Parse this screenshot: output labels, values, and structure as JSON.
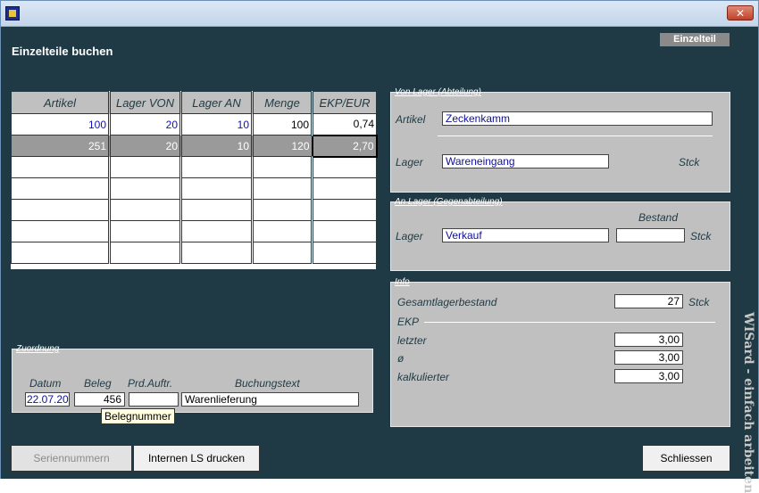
{
  "page": {
    "title": "Einzelteile buchen",
    "badge": "Einzelteil"
  },
  "grid": {
    "headers": [
      "Artikel",
      "Lager VON",
      "Lager AN",
      "Menge",
      "EKP/EUR"
    ],
    "rows": [
      [
        "100",
        "20",
        "10",
        "100",
        "0,74"
      ],
      [
        "251",
        "20",
        "10",
        "120",
        "2,70"
      ]
    ]
  },
  "von_lager": {
    "legend": "Von Lager (Abteilung)",
    "artikel_label": "Artikel",
    "artikel_value": "Zeckenkamm",
    "lager_label": "Lager",
    "lager_value": "Wareneingang",
    "unit": "Stck"
  },
  "an_lager": {
    "legend": "An Lager (Gegenabteilung)",
    "bestand_label": "Bestand",
    "lager_label": "Lager",
    "lager_value": "Verkauf",
    "bestand_value": "",
    "unit": "Stck"
  },
  "info": {
    "legend": "Info",
    "gesamt_label": "Gesamtlagerbestand",
    "gesamt_value": "27",
    "unit": "Stck",
    "ekp_label": "EKP",
    "letzter_label": "letzter",
    "letzter_value": "3,00",
    "avg_label": "ø",
    "avg_value": "3,00",
    "kalk_label": "kalkulierter",
    "kalk_value": "3,00"
  },
  "zuordnung": {
    "legend": "Zuordnung",
    "datum_label": "Datum",
    "datum_value": "22.07.20",
    "beleg_label": "Beleg",
    "beleg_value": "456",
    "prd_label": "Prd.Auftr.",
    "prd_value": "",
    "text_label": "Buchungstext",
    "text_value": "Warenlieferung",
    "tooltip": "Belegnummer"
  },
  "buttons": {
    "serien": "Seriennummern",
    "ls": "Internen LS drucken",
    "close": "Schliessen"
  },
  "side_text": "WISard - einfach arbeiten"
}
